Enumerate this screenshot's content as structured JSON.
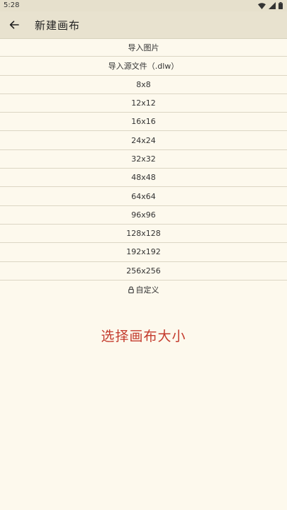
{
  "status_bar": {
    "time": "5:28",
    "icons": [
      "wifi-icon",
      "signal-icon",
      "battery-icon"
    ]
  },
  "app_bar": {
    "back_icon": "arrow-left-icon",
    "title": "新建画布"
  },
  "options": [
    {
      "label": "导入图片"
    },
    {
      "label": "导入源文件（.dlw）"
    },
    {
      "label": "8x8"
    },
    {
      "label": "12x12"
    },
    {
      "label": "16x16"
    },
    {
      "label": "24x24"
    },
    {
      "label": "32x32"
    },
    {
      "label": "48x48"
    },
    {
      "label": "64x64"
    },
    {
      "label": "96x96"
    },
    {
      "label": "128x128"
    },
    {
      "label": "192x192"
    },
    {
      "label": "256x256"
    },
    {
      "label": "自定义",
      "icon": "lock-icon"
    }
  ],
  "hint": "选择画布大小",
  "colors": {
    "background": "#fdf9ed",
    "app_bar": "#e8e2cf",
    "hint": "#c43c2e",
    "divider": "#dcd6c4"
  }
}
